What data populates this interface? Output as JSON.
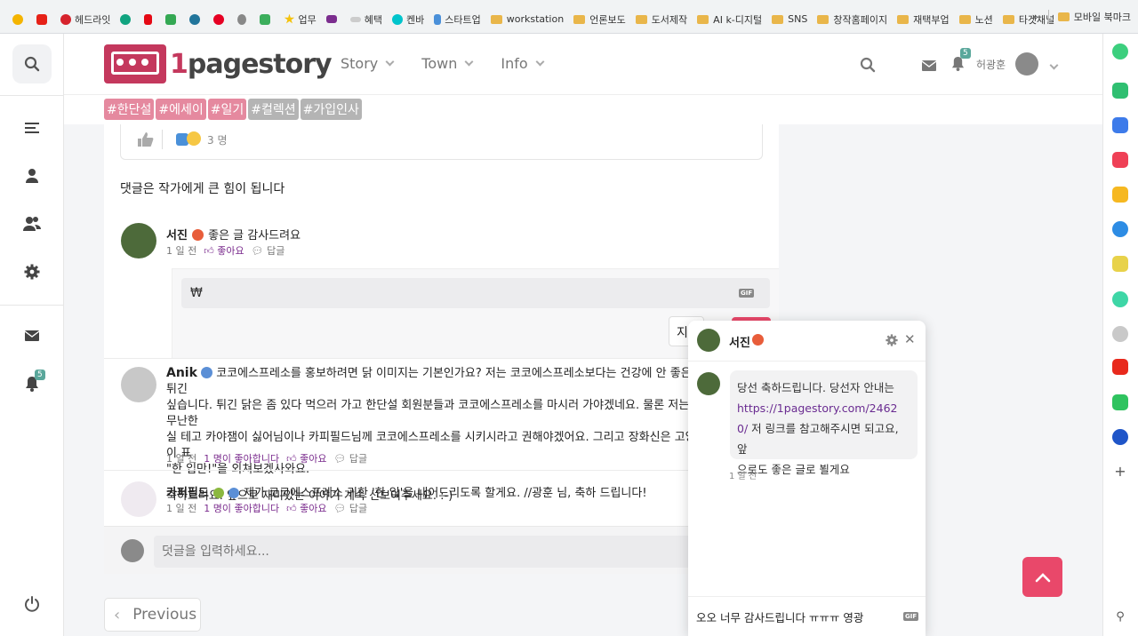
{
  "bookmarks": {
    "items": [
      {
        "label": "",
        "icon": "sunflower-icon",
        "color": "#f4b400"
      },
      {
        "label": "",
        "icon": "youtube-icon",
        "color": "#e62117"
      },
      {
        "label": "헤드라잇",
        "icon": "headlight-icon",
        "color": "#d6232c"
      },
      {
        "label": "",
        "icon": "chatgpt-icon",
        "color": "#10a37f"
      },
      {
        "label": "",
        "icon": "netflix-icon",
        "color": "#e50914"
      },
      {
        "label": "",
        "icon": "chart-icon",
        "color": "#34a853"
      },
      {
        "label": "",
        "icon": "wordpress-icon",
        "color": "#21759b"
      },
      {
        "label": "",
        "icon": "pinterest-icon",
        "color": "#e60023"
      },
      {
        "label": "",
        "icon": "apple-icon",
        "color": "#888888"
      },
      {
        "label": "",
        "icon": "hexagon-icon",
        "color": "#3cae5c"
      },
      {
        "label": "업무",
        "icon": "star-icon",
        "color": "#f4c20d"
      },
      {
        "label": "",
        "icon": "mail-icon",
        "color": "#7b2d8e"
      },
      {
        "label": "혜택",
        "icon": "aw-icon",
        "color": "#555555"
      },
      {
        "label": "켄바",
        "icon": "canva-icon",
        "color": "#00c4cc"
      },
      {
        "label": "스타트업",
        "icon": "p-icon",
        "color": "#4a90d9"
      }
    ],
    "folders": [
      "workstation",
      "언론보도",
      "도서제작",
      "AI k-디지털",
      "SNS",
      "창작홈페이지",
      "재택부업",
      "노션",
      "타겟채널"
    ],
    "more": "»",
    "mobile": "모바일 북마크"
  },
  "sidebar": {
    "badge": "5"
  },
  "header": {
    "logo_one": "1",
    "logo_rest": "pagestory",
    "nav": [
      "Story",
      "Town",
      "Info"
    ],
    "badge": "5",
    "username": "허광훈"
  },
  "tags": [
    {
      "label": "#한단설",
      "color": "#e5899f"
    },
    {
      "label": "#에세이",
      "color": "#e5899f"
    },
    {
      "label": "#일기",
      "color": "#e5899f"
    },
    {
      "label": "#컬렉션",
      "color": "#b4b4b4"
    },
    {
      "label": "#가입인사",
      "color": "#b4b4b4"
    }
  ],
  "post": {
    "like_count": "3 명",
    "comment_hint": "댓글은 작가에게 큰 힘이 됩니다"
  },
  "comments": [
    {
      "name": "서진",
      "text": "좋은 글 감사드려요",
      "time": "1 일 전",
      "likes_text": "",
      "like_label": "좋아요",
      "reply_label": "답글"
    },
    {
      "name": "Anik",
      "lines": [
        "코코에스프레소를 홍보하려면 닭 이미지는 기본인가요? 저는 코코에스프레소보다는 건강에 안 좋은 튀긴",
        "싶습니다. 튀긴 닭은 좀 있다 먹으러 가고 한단설 회원분들과 코코에스프레소를 마시러 가야겠네요. 물론 저는 무난한",
        "실 테고 카야잼이 싫어님이나 카피필드님께 코코에스프레소를 시키시라고 권해야겠어요. 그리고 장화신은 고양이 표",
        "\"한 입만!\"을 외쳐보겠사와요."
      ],
      "extra": "축하드려요. 앞으로 재미있는 이야기 계속 선보여주세요. :-)",
      "time": "1 일 전",
      "likes_text": "1 명이 좋아합니다",
      "like_label": "좋아요",
      "reply_label": "답글"
    },
    {
      "name": "카퍼필드",
      "text": "제가 코코에스프레소 귀한 '한 입'을 내어드리도록 할게요. //광훈 님, 축하 드립니다!",
      "time": "1 일 전",
      "likes_text": "1 명이 좋아합니다",
      "like_label": "좋아요",
      "reply_label": "답글"
    }
  ],
  "reply_box": {
    "value": "₩",
    "gif": "GIF",
    "submit_partial": "지"
  },
  "comment_input": {
    "placeholder": "덧글을 입력하세요..."
  },
  "pagination": {
    "previous": "Previous"
  },
  "chat": {
    "title": "서진",
    "message_before": "당선 축하드립니다. 당선자 안내는",
    "link_line1": "https://1pagestory.com/2462",
    "link_line2": "0/",
    "message_after1": " 저 링크를 참고해주시면 되고요, 앞",
    "message_after2": "으로도 좋은 글로 뵐게요",
    "time": "1 일 전",
    "input": "오오 너무 감사드립니다 ㅠㅠㅠ 영광",
    "gif": "GIF"
  },
  "colors": {
    "brand": "#c4385d",
    "accent_purple": "#7b2d8e",
    "scroll_top": "#e9486a",
    "badge": "#5aa79b"
  }
}
